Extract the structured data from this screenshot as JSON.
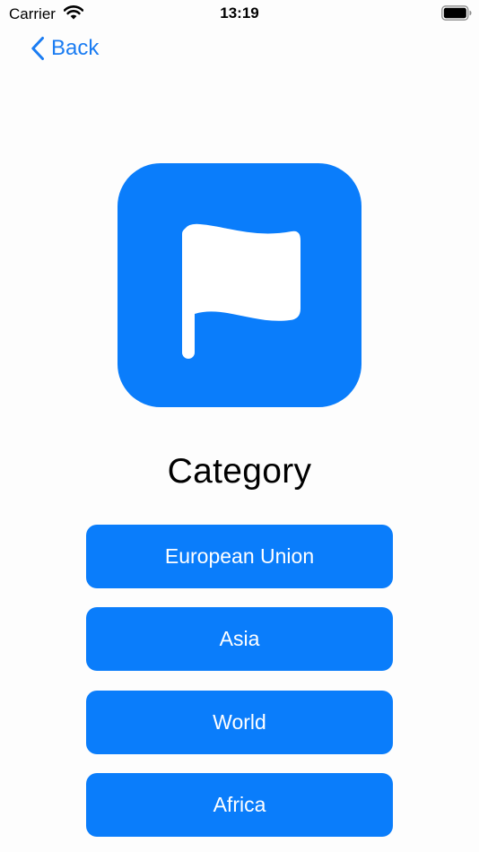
{
  "status_bar": {
    "carrier": "Carrier",
    "time": "13:19",
    "icons": [
      "wifi-icon",
      "battery-icon"
    ]
  },
  "nav": {
    "back_label": "Back",
    "back_icon": "chevron-left-icon"
  },
  "main": {
    "icon": "flag-icon",
    "title": "Category",
    "buttons": [
      {
        "label": "European Union"
      },
      {
        "label": "Asia"
      },
      {
        "label": "World"
      },
      {
        "label": "Africa"
      }
    ]
  },
  "colors": {
    "accent": "#0a7dfb",
    "link": "#1a7cf2",
    "background": "#fdfdfd",
    "button_text": "#ffffff"
  }
}
